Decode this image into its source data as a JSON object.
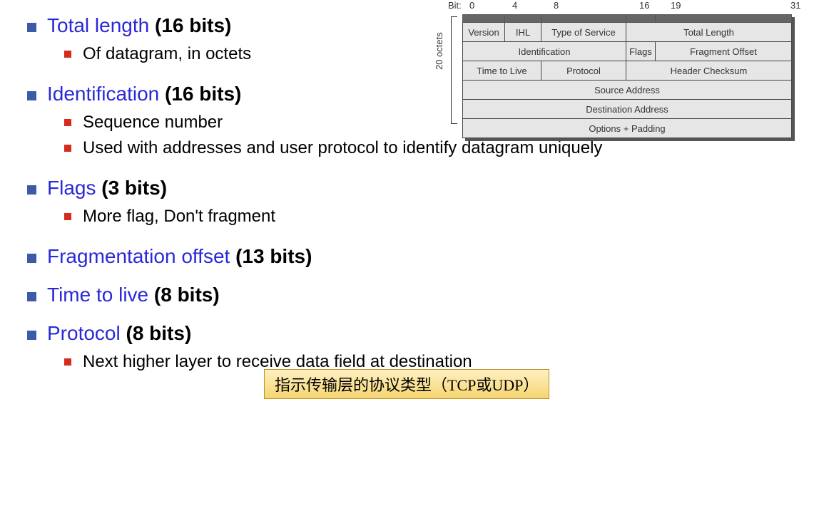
{
  "items": [
    {
      "title": "Total length",
      "bits": "(16 bits)",
      "subs": [
        "Of datagram, in octets"
      ]
    },
    {
      "title": "Identification",
      "bits": "(16 bits)",
      "subs": [
        "Sequence number",
        "Used with addresses and user protocol to identify datagram uniquely"
      ]
    },
    {
      "title": "Flags",
      "bits": "(3 bits)",
      "subs": [
        "More flag, Don't fragment"
      ]
    },
    {
      "title": "Fragmentation offset",
      "bits": "(13 bits)",
      "subs": []
    },
    {
      "title": "Time to live",
      "bits": "(8 bits)",
      "subs": []
    },
    {
      "title": "Protocol",
      "bits": "(8 bits)",
      "subs": [
        "Next higher layer to receive data field at destination"
      ]
    }
  ],
  "note": "指示传输层的协议类型（TCP或UDP）",
  "diagram": {
    "bit_label": "Bit:",
    "bits": {
      "b0": "0",
      "b4": "4",
      "b8": "8",
      "b16": "16",
      "b19": "19",
      "b31": "31"
    },
    "vlabel": "20 octets",
    "cells": {
      "version": "Version",
      "ihl": "IHL",
      "tos": "Type of Service",
      "tlen": "Total Length",
      "ident": "Identification",
      "flags": "Flags",
      "foff": "Fragment Offset",
      "ttl": "Time to Live",
      "proto": "Protocol",
      "hchk": "Header Checksum",
      "saddr": "Source Address",
      "daddr": "Destination Address",
      "opt": "Options + Padding"
    }
  }
}
